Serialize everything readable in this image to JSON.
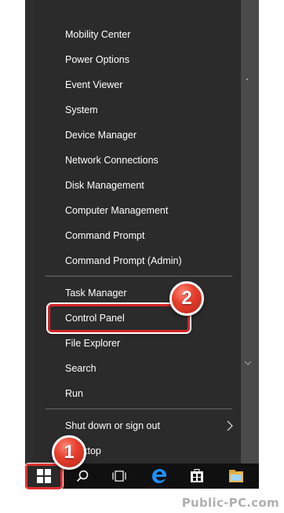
{
  "menu": {
    "items": [
      {
        "label": "Mobility Center"
      },
      {
        "label": "Power Options"
      },
      {
        "label": "Event Viewer"
      },
      {
        "label": "System"
      },
      {
        "label": "Device Manager"
      },
      {
        "label": "Network Connections"
      },
      {
        "label": "Disk Management"
      },
      {
        "label": "Computer Management"
      },
      {
        "label": "Command Prompt"
      },
      {
        "label": "Command Prompt (Admin)"
      },
      {
        "label": "Task Manager"
      },
      {
        "label": "Control Panel"
      },
      {
        "label": "File Explorer"
      },
      {
        "label": "Search"
      },
      {
        "label": "Run"
      },
      {
        "label": "Shut down or sign out"
      },
      {
        "label": "Desktop"
      }
    ]
  },
  "annotations": {
    "badge1": "1",
    "badge2": "2",
    "badge_color": "#e8402e"
  },
  "taskbar": {
    "icons": [
      "windows-start-icon",
      "search-icon",
      "task-view-icon",
      "edge-icon",
      "store-icon",
      "file-explorer-icon"
    ]
  },
  "watermark": "Public-PC.com"
}
